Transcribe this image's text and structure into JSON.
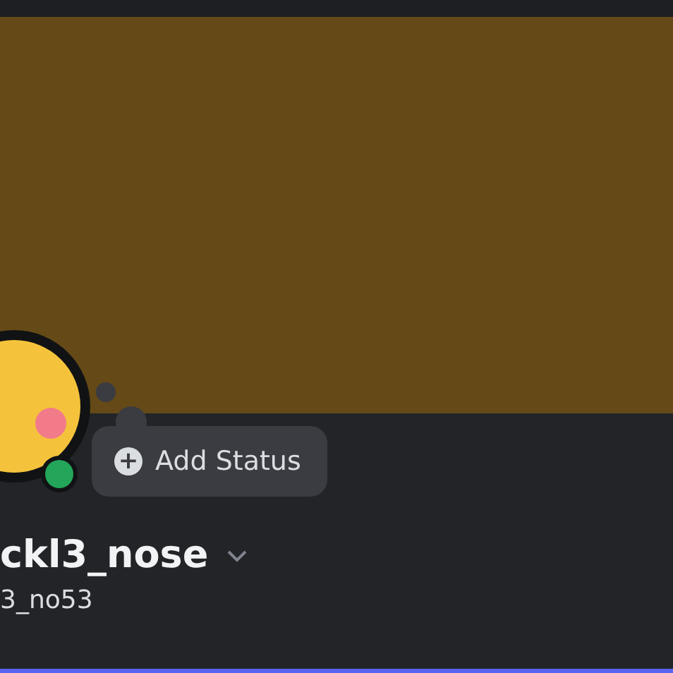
{
  "profile": {
    "online": true,
    "add_status": {
      "icon": "+",
      "label": "Add Status"
    },
    "display_name": "ckl3_nose",
    "username": "3_no53"
  }
}
